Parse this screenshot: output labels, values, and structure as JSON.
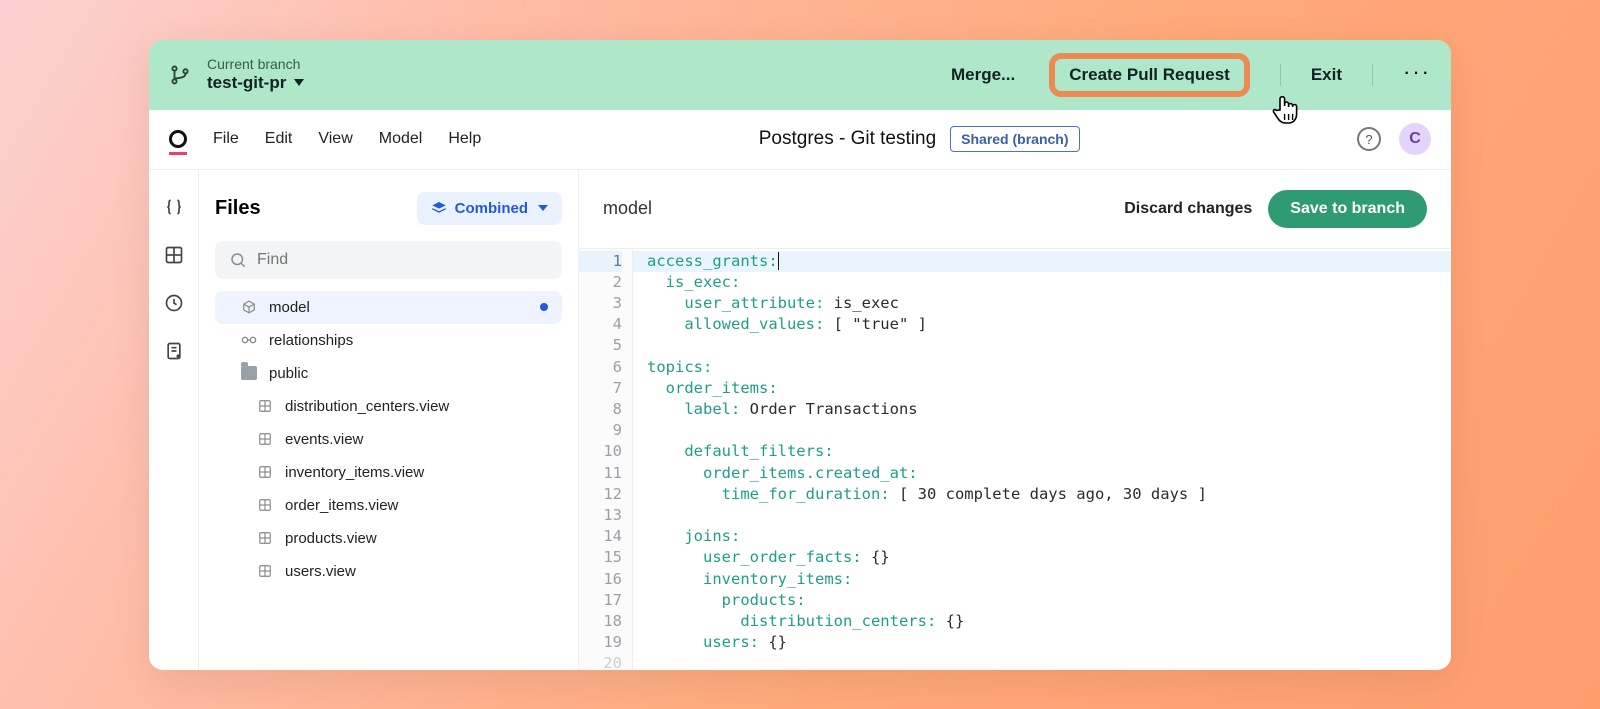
{
  "branch": {
    "label": "Current branch",
    "name": "test-git-pr",
    "actions": {
      "merge": "Merge...",
      "create_pr": "Create Pull Request",
      "exit": "Exit"
    }
  },
  "menu": {
    "items": [
      "File",
      "Edit",
      "View",
      "Model",
      "Help"
    ],
    "project_title": "Postgres - Git testing",
    "shared_badge": "Shared (branch)",
    "help_glyph": "?",
    "avatar_initial": "C"
  },
  "sidebar": {
    "title": "Files",
    "combined_label": "Combined",
    "find_placeholder": "Find",
    "tree": [
      {
        "icon": "cube",
        "label": "model",
        "active": true,
        "modified": true,
        "indent": 0
      },
      {
        "icon": "link",
        "label": "relationships",
        "indent": 0
      },
      {
        "icon": "folder",
        "label": "public",
        "indent": 0
      },
      {
        "icon": "grid",
        "label": "distribution_centers.view",
        "indent": 1
      },
      {
        "icon": "grid",
        "label": "events.view",
        "indent": 1
      },
      {
        "icon": "grid",
        "label": "inventory_items.view",
        "indent": 1
      },
      {
        "icon": "grid",
        "label": "order_items.view",
        "indent": 1
      },
      {
        "icon": "grid",
        "label": "products.view",
        "indent": 1
      },
      {
        "icon": "grid",
        "label": "users.view",
        "indent": 1
      }
    ]
  },
  "editor": {
    "tab": "model",
    "discard_label": "Discard changes",
    "save_label": "Save to branch",
    "lines": [
      [
        {
          "t": "key",
          "v": "access_grants:"
        }
      ],
      [
        {
          "t": "indent",
          "n": 2
        },
        {
          "t": "key",
          "v": "is_exec:"
        }
      ],
      [
        {
          "t": "indent",
          "n": 4
        },
        {
          "t": "key",
          "v": "user_attribute:"
        },
        {
          "t": "plain",
          "v": " is_exec"
        }
      ],
      [
        {
          "t": "indent",
          "n": 4
        },
        {
          "t": "key",
          "v": "allowed_values:"
        },
        {
          "t": "plain",
          "v": " [ \"true\" ]"
        }
      ],
      [],
      [
        {
          "t": "key",
          "v": "topics:"
        }
      ],
      [
        {
          "t": "indent",
          "n": 2
        },
        {
          "t": "key",
          "v": "order_items:"
        }
      ],
      [
        {
          "t": "indent",
          "n": 4
        },
        {
          "t": "key",
          "v": "label:"
        },
        {
          "t": "plain",
          "v": " Order Transactions"
        }
      ],
      [],
      [
        {
          "t": "indent",
          "n": 4
        },
        {
          "t": "key",
          "v": "default_filters:"
        }
      ],
      [
        {
          "t": "indent",
          "n": 6
        },
        {
          "t": "key",
          "v": "order_items.created_at:"
        }
      ],
      [
        {
          "t": "indent",
          "n": 8
        },
        {
          "t": "key",
          "v": "time_for_duration:"
        },
        {
          "t": "plain",
          "v": " [ 30 complete days ago, 30 days ]"
        }
      ],
      [],
      [
        {
          "t": "indent",
          "n": 4
        },
        {
          "t": "key",
          "v": "joins:"
        }
      ],
      [
        {
          "t": "indent",
          "n": 6
        },
        {
          "t": "key",
          "v": "user_order_facts:"
        },
        {
          "t": "plain",
          "v": " {}"
        }
      ],
      [
        {
          "t": "indent",
          "n": 6
        },
        {
          "t": "key",
          "v": "inventory_items:"
        }
      ],
      [
        {
          "t": "indent",
          "n": 8
        },
        {
          "t": "key",
          "v": "products:"
        }
      ],
      [
        {
          "t": "indent",
          "n": 10
        },
        {
          "t": "key",
          "v": "distribution_centers:"
        },
        {
          "t": "plain",
          "v": " {}"
        }
      ],
      [
        {
          "t": "indent",
          "n": 6
        },
        {
          "t": "key",
          "v": "users:"
        },
        {
          "t": "plain",
          "v": " {}"
        }
      ]
    ],
    "highlight_line": 1
  }
}
